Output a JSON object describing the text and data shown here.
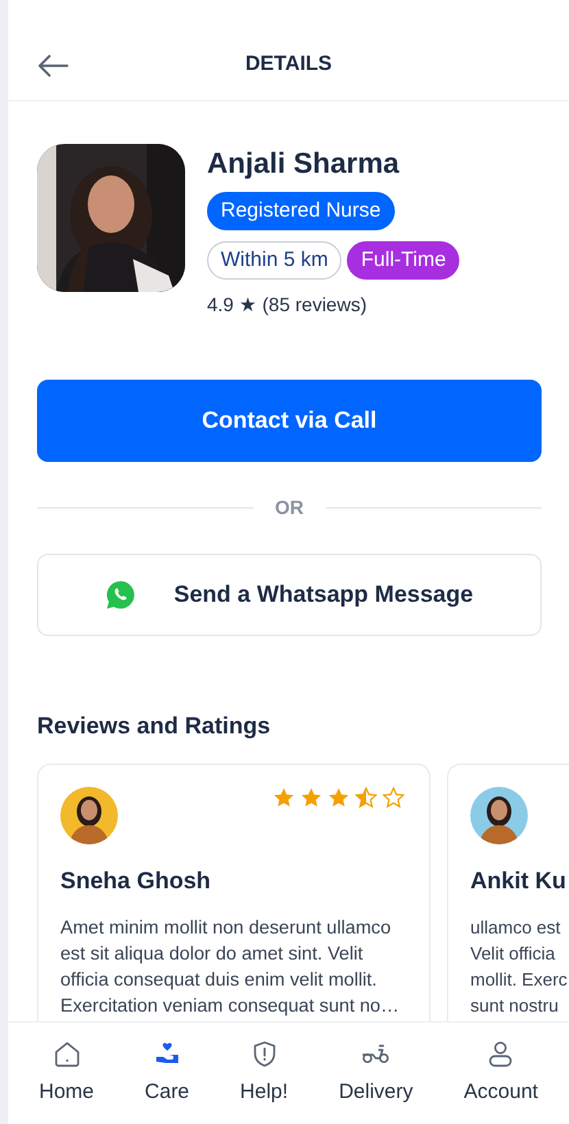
{
  "header": {
    "title": "DETAILS"
  },
  "profile": {
    "name": "Anjali Sharma",
    "tags": [
      {
        "label": "Registered Nurse",
        "kind": "solid",
        "color": "#0066ff"
      },
      {
        "label": "Within 5 km",
        "kind": "outline",
        "color": "#ffffff"
      },
      {
        "label": "Full-Time",
        "kind": "solid",
        "color": "#a82fe0"
      }
    ],
    "rating": "4.9 ★ (85 reviews)"
  },
  "contact_button": "Contact via Call",
  "divider": "OR",
  "whatsapp_button": "Send a Whatsapp Message",
  "reviews_title": "Reviews and Ratings",
  "reviews": [
    {
      "name": "Sneha Ghosh",
      "stars": 3.5,
      "text": "Amet minim mollit non deserunt ullamco est sit aliqua dolor do amet sint. Velit officia consequat duis enim velit mollit. Exercitation veniam consequat sunt no…"
    },
    {
      "name": "Ankit Ku",
      "lines": [
        "ullamco est",
        "Velit officia",
        "mollit. Exerc",
        "sunt nostru"
      ]
    }
  ],
  "nav": [
    {
      "label": "Home",
      "selected": false
    },
    {
      "label": "Care",
      "selected": true
    },
    {
      "label": "Help!",
      "selected": false
    },
    {
      "label": "Delivery",
      "selected": false
    },
    {
      "label": "Account",
      "selected": false
    }
  ]
}
